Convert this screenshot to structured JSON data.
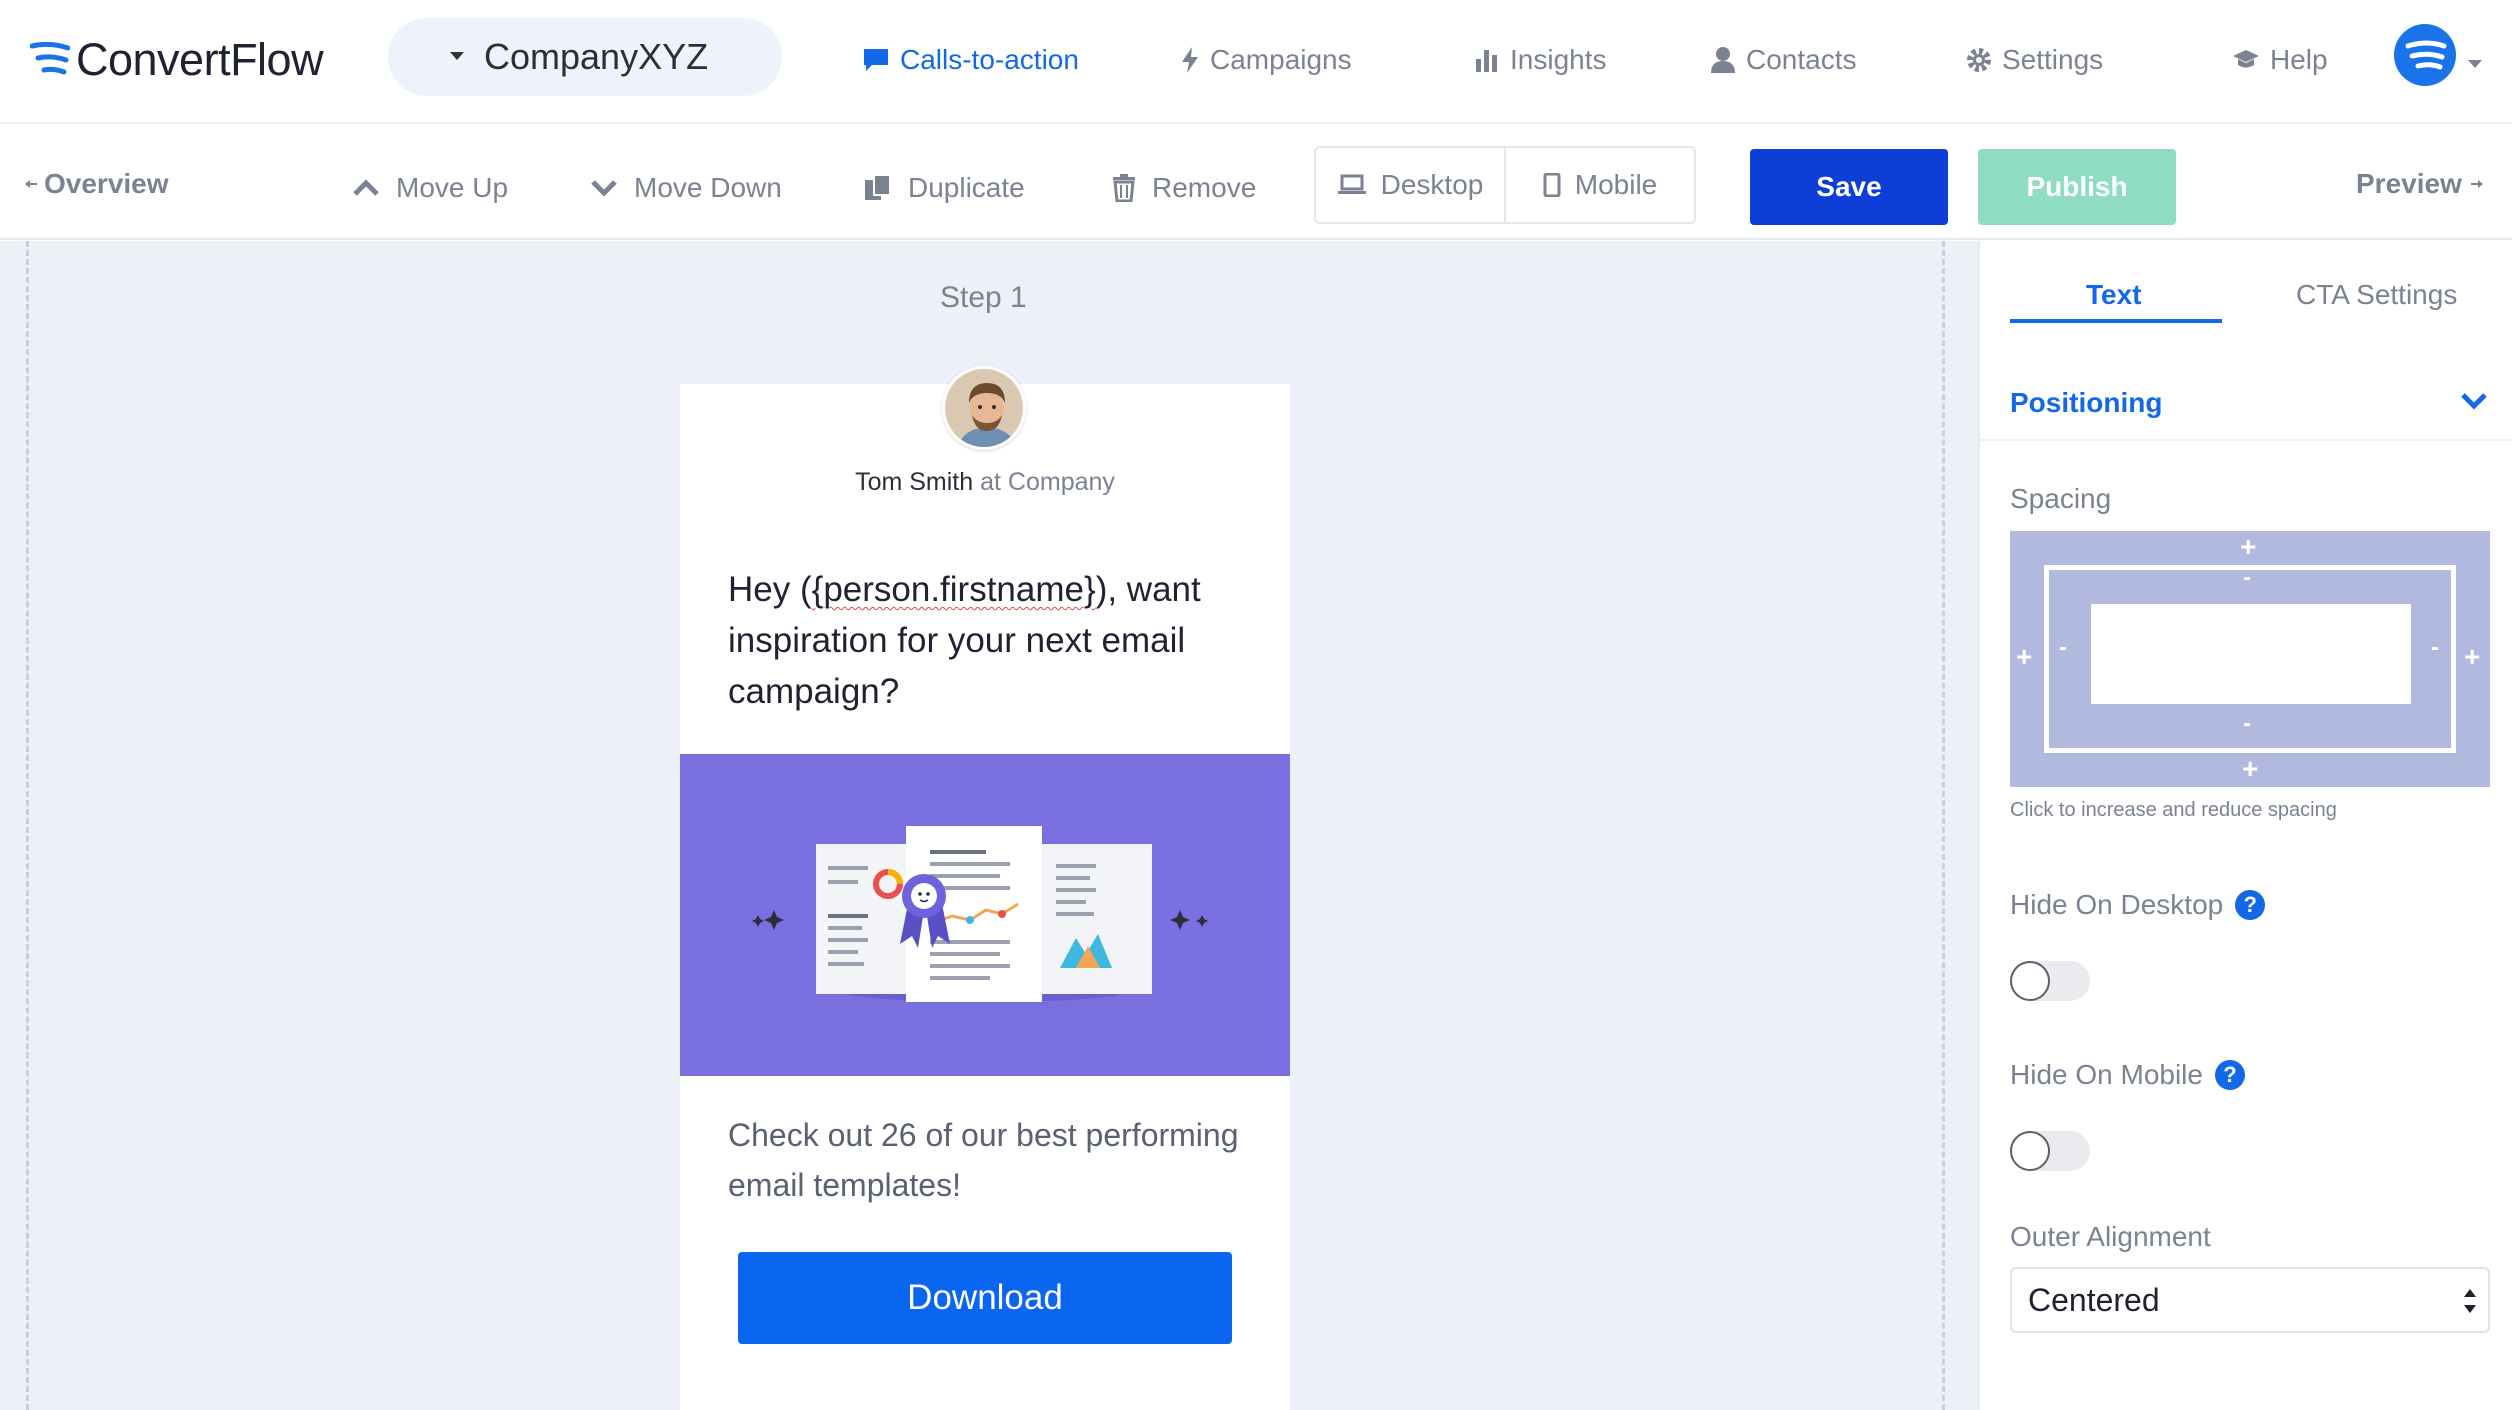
{
  "app": {
    "logo_text": "ConvertFlow",
    "company": "CompanyXYZ"
  },
  "nav": {
    "items": [
      {
        "label": "Calls-to-action",
        "icon": "chat-icon",
        "active": true
      },
      {
        "label": "Campaigns",
        "icon": "bolt-icon"
      },
      {
        "label": "Insights",
        "icon": "bar-chart-icon"
      },
      {
        "label": "Contacts",
        "icon": "user-icon"
      },
      {
        "label": "Settings",
        "icon": "gear-icon"
      },
      {
        "label": "Help",
        "icon": "graduation-cap-icon"
      }
    ]
  },
  "toolbar": {
    "overview": "Overview",
    "move_up": "Move Up",
    "move_down": "Move Down",
    "duplicate": "Duplicate",
    "remove": "Remove",
    "desktop": "Desktop",
    "mobile": "Mobile",
    "save": "Save",
    "publish": "Publish",
    "preview": "Preview"
  },
  "canvas": {
    "step_label": "Step 1",
    "card": {
      "author_name": "Tom Smith",
      "author_at": "at Company",
      "headline_pre": "Hey (",
      "headline_var": "{person.firstname}",
      "headline_post": "), want inspiration for your next email campaign?",
      "body": "Check out 26 of our best performing email templates!",
      "button": "Download"
    }
  },
  "panel": {
    "tabs": [
      "Text",
      "CTA Settings"
    ],
    "section": "Positioning",
    "spacing_label": "Spacing",
    "spacing_help": "Click to increase and reduce spacing",
    "hide_desktop": "Hide On Desktop",
    "hide_mobile": "Hide On Mobile",
    "outer_alignment": "Outer Alignment",
    "alignment_value": "Centered",
    "help_glyph": "?"
  },
  "colors": {
    "accent": "#1368e8",
    "save": "#0d3fd8",
    "publish": "#8fdcc3",
    "hero": "#7a6fe0",
    "download": "#0a66f0"
  }
}
